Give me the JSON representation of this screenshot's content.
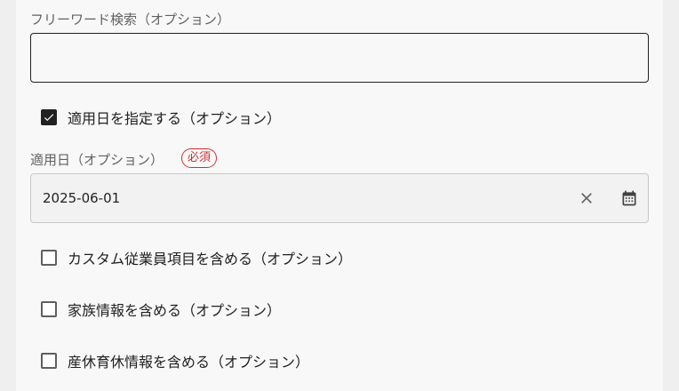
{
  "free_word": {
    "label": "フリーワード検索（オプション）",
    "value": ""
  },
  "specify_date": {
    "label": "適用日を指定する（オプション）",
    "checked": true
  },
  "application_date": {
    "label": "適用日（オプション）",
    "required_badge": "必須",
    "value": "2025-06-01",
    "clear_icon": "close-icon",
    "calendar_icon": "calendar-icon"
  },
  "options": [
    {
      "label": "カスタム従業員項目を含める（オプション）",
      "checked": false
    },
    {
      "label": "家族情報を含める（オプション）",
      "checked": false
    },
    {
      "label": "産休育休情報を含める（オプション）",
      "checked": false
    }
  ],
  "colors": {
    "accent": "#212121",
    "required": "#d32f2f",
    "background": "#f8f8f8"
  }
}
